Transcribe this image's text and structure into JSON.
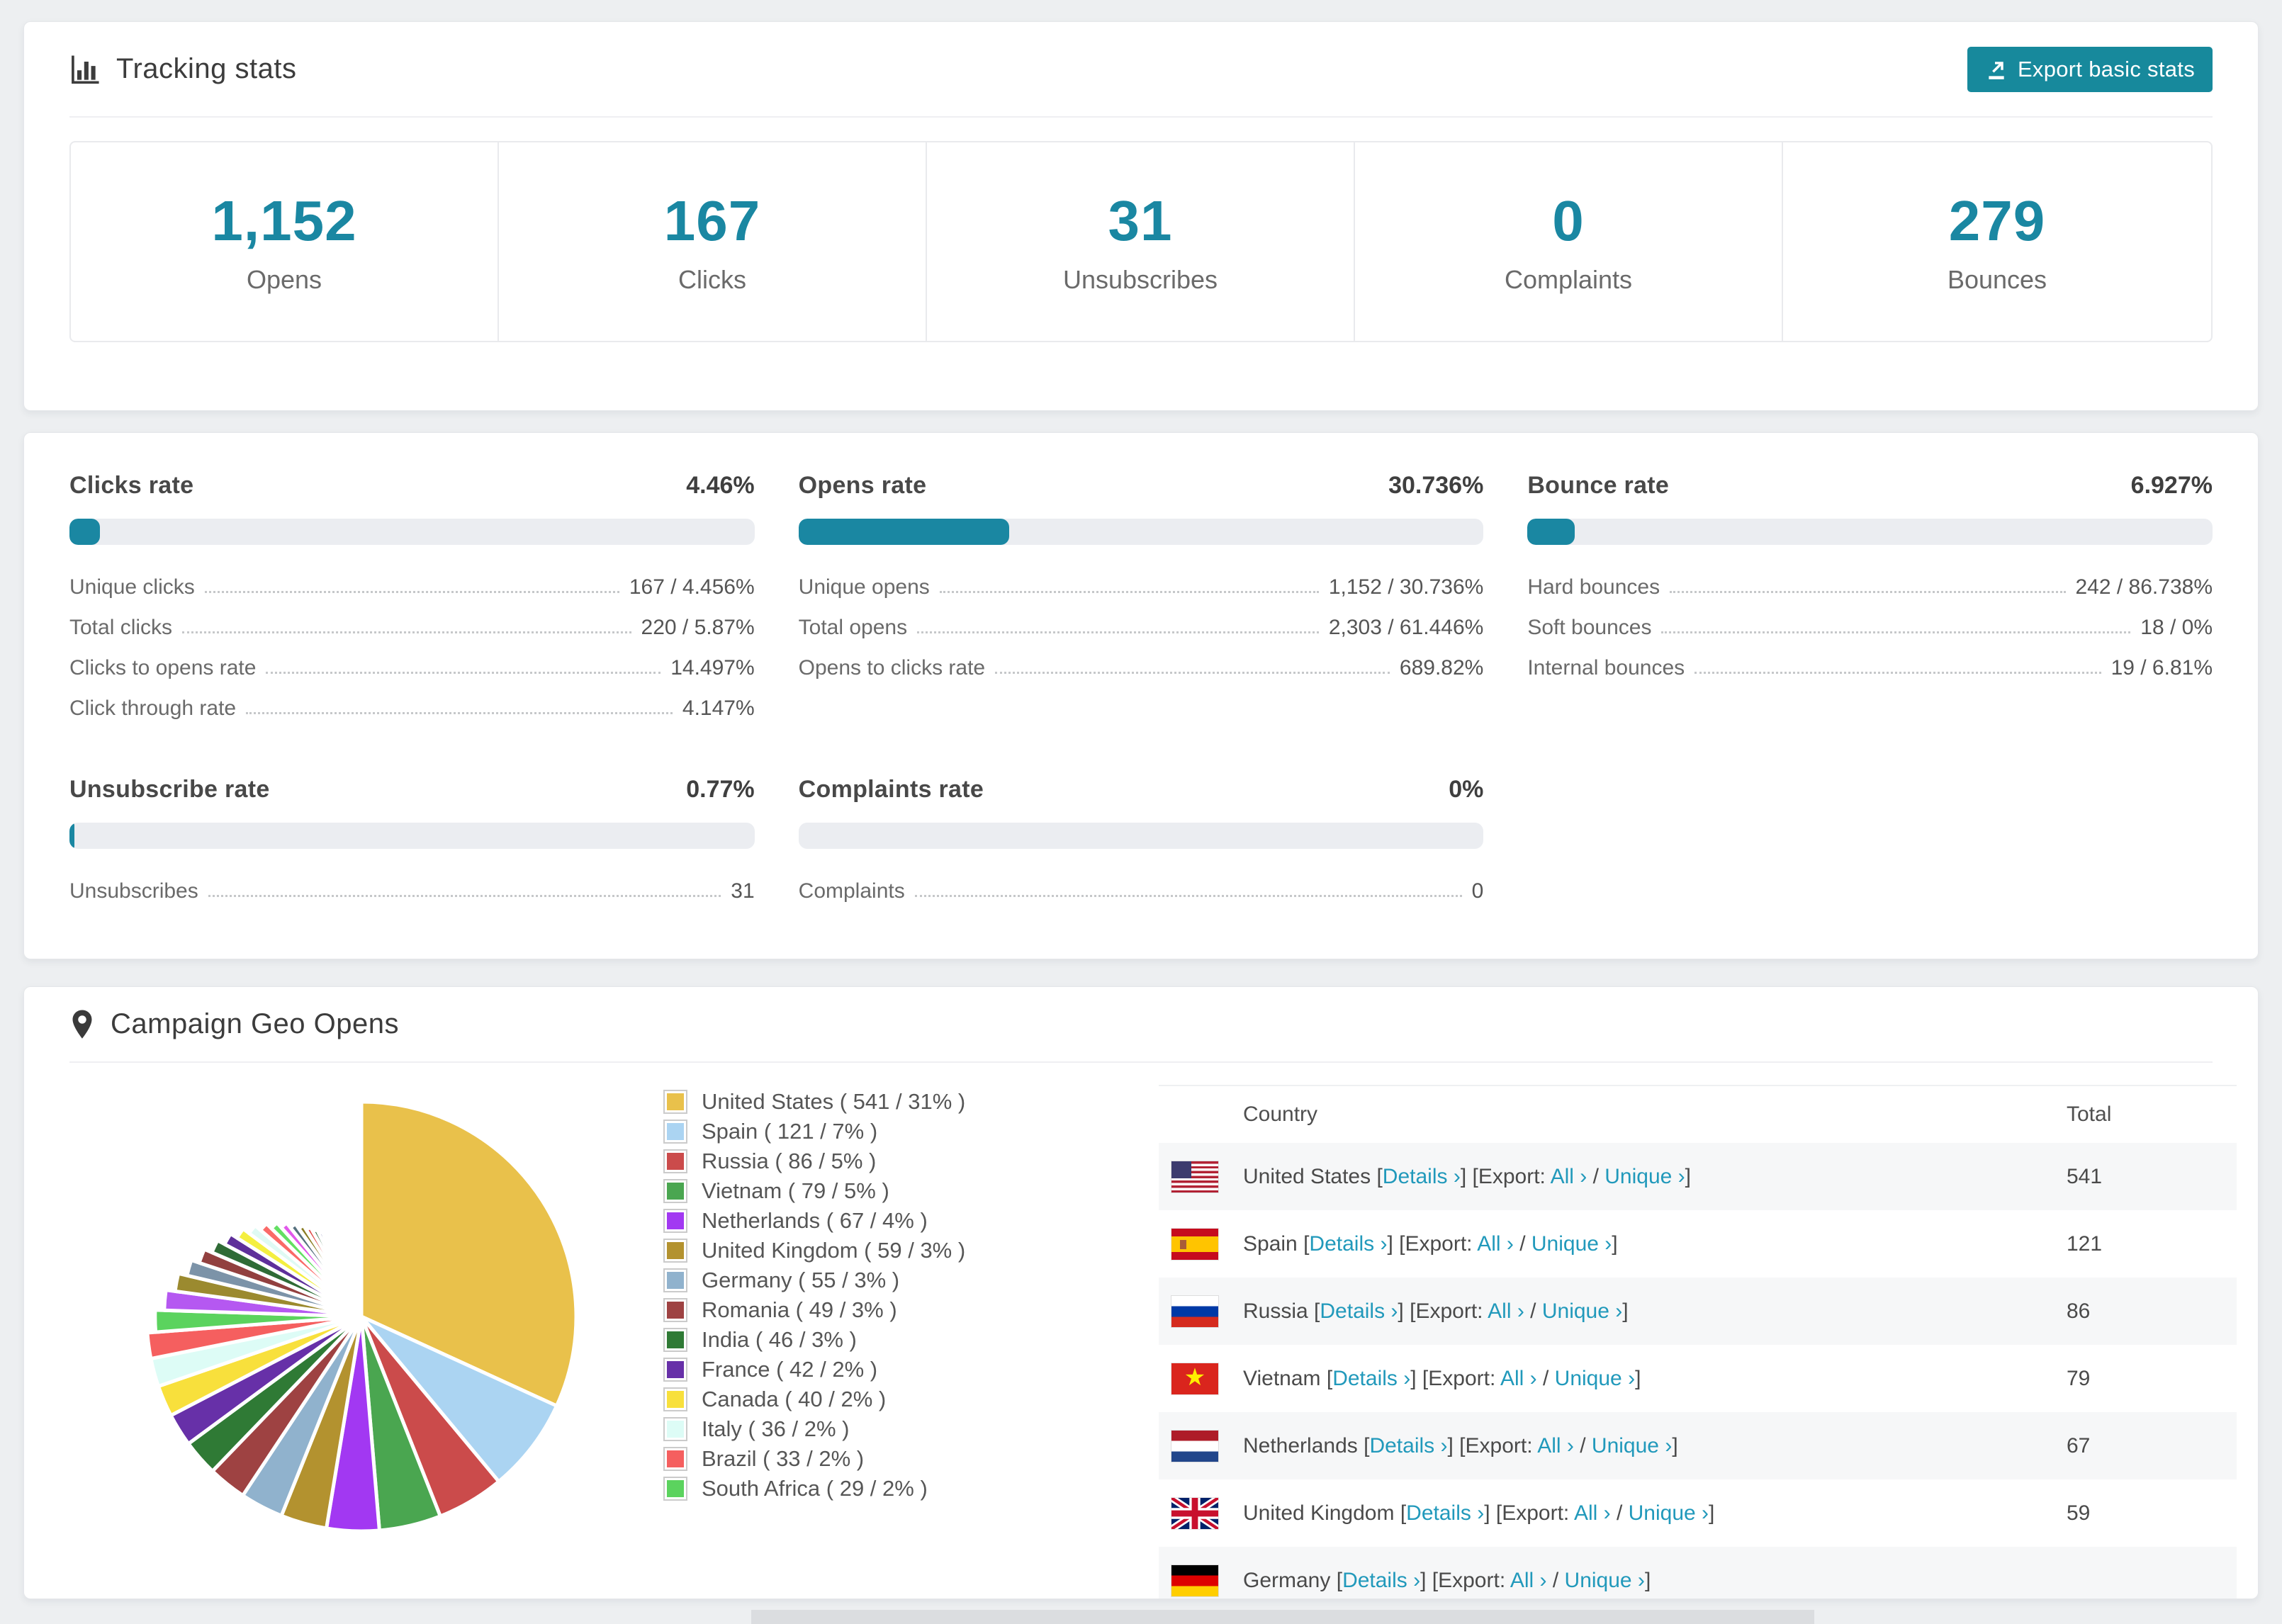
{
  "page": {
    "background": "#edeff1",
    "accent_color": "#1a87a2"
  },
  "tracking_card": {
    "title": "Tracking stats",
    "icon": "bar-chart-icon",
    "export_button": {
      "label": "Export basic stats",
      "icon": "export-icon",
      "color": "#17899c"
    },
    "stats": [
      {
        "value": "1,152",
        "label": "Opens"
      },
      {
        "value": "167",
        "label": "Clicks"
      },
      {
        "value": "31",
        "label": "Unsubscribes"
      },
      {
        "value": "0",
        "label": "Complaints"
      },
      {
        "value": "279",
        "label": "Bounces"
      }
    ]
  },
  "rates_card": {
    "blocks": [
      {
        "title": "Clicks rate",
        "value": "4.46%",
        "percent": 4.46,
        "rows": [
          {
            "label": "Unique clicks",
            "value": "167 / 4.456%"
          },
          {
            "label": "Total clicks",
            "value": "220 / 5.87%"
          },
          {
            "label": "Clicks to opens rate",
            "value": "14.497%"
          },
          {
            "label": "Click through rate",
            "value": "4.147%"
          }
        ]
      },
      {
        "title": "Opens rate",
        "value": "30.736%",
        "percent": 30.736,
        "rows": [
          {
            "label": "Unique opens",
            "value": "1,152 / 30.736%"
          },
          {
            "label": "Total opens",
            "value": "2,303 / 61.446%"
          },
          {
            "label": "Opens to clicks rate",
            "value": "689.82%"
          }
        ]
      },
      {
        "title": "Bounce rate",
        "value": "6.927%",
        "percent": 6.927,
        "rows": [
          {
            "label": "Hard bounces",
            "value": "242 / 86.738%"
          },
          {
            "label": "Soft bounces",
            "value": "18 / 0%"
          },
          {
            "label": "Internal bounces",
            "value": "19 / 6.81%"
          }
        ]
      },
      {
        "title": "Unsubscribe rate",
        "value": "0.77%",
        "percent": 0.77,
        "rows": [
          {
            "label": "Unsubscribes",
            "value": "31"
          }
        ]
      },
      {
        "title": "Complaints rate",
        "value": "0%",
        "percent": 0,
        "rows": [
          {
            "label": "Complaints",
            "value": "0"
          }
        ]
      }
    ]
  },
  "geo_card": {
    "title": "Campaign Geo Opens",
    "icon": "map-pin-icon",
    "chart_data": {
      "type": "pie",
      "title": "Campaign Geo Opens",
      "legend_position": "right",
      "start_angle_deg": 0,
      "direction": "clockwise",
      "slices": [
        {
          "name": "United States",
          "value": 541,
          "legend": "United States ( 541 / 31% )",
          "color": "#e9c14b"
        },
        {
          "name": "Spain",
          "value": 121,
          "legend": "Spain ( 121 / 7% )",
          "color": "#abd4f2"
        },
        {
          "name": "Russia",
          "value": 86,
          "legend": "Russia ( 86 / 5% )",
          "color": "#cb4b4b"
        },
        {
          "name": "Vietnam",
          "value": 79,
          "legend": "Vietnam ( 79 / 5% )",
          "color": "#4aa650"
        },
        {
          "name": "Netherlands",
          "value": 67,
          "legend": "Netherlands ( 67 / 4% )",
          "color": "#a238f2"
        },
        {
          "name": "United Kingdom",
          "value": 59,
          "legend": "United Kingdom ( 59 / 3% )",
          "color": "#b3922f"
        },
        {
          "name": "Germany",
          "value": 55,
          "legend": "Germany ( 55 / 3% )",
          "color": "#90b2cd"
        },
        {
          "name": "Romania",
          "value": 49,
          "legend": "Romania ( 49 / 3% )",
          "color": "#9e4242"
        },
        {
          "name": "India",
          "value": 46,
          "legend": "India ( 46 / 3% )",
          "color": "#2f7a35"
        },
        {
          "name": "France",
          "value": 42,
          "legend": "France ( 42 / 2% )",
          "color": "#6730a8"
        },
        {
          "name": "Canada",
          "value": 40,
          "legend": "Canada ( 40 / 2% )",
          "color": "#f8e03c"
        },
        {
          "name": "Italy",
          "value": 36,
          "legend": "Italy ( 36 / 2% )",
          "color": "#ddfcf6"
        },
        {
          "name": "Brazil",
          "value": 33,
          "legend": "Brazil ( 33 / 2% )",
          "color": "#f55f5f"
        },
        {
          "name": "South Africa",
          "value": 29,
          "legend": "South Africa ( 29 / 2% )",
          "color": "#5bd35e"
        }
      ],
      "tail_slices": {
        "comment_values_are_estimates_of_unlabeled_small_slices": true,
        "values": [
          28,
          26,
          24,
          23,
          22,
          21,
          20,
          19,
          18,
          17,
          16,
          15,
          14,
          13,
          12,
          11,
          10,
          9.5,
          9,
          8.5,
          8,
          7.5,
          7,
          6.5,
          6,
          5.5,
          5,
          4.5,
          4,
          3.5,
          3,
          2.8,
          2.6,
          2.4,
          2.2,
          2,
          1.8,
          1.6,
          1.4,
          1.2,
          1,
          0.9
        ],
        "palette": [
          "#b558f1",
          "#9b8a2f",
          "#7c93a8",
          "#92403f",
          "#2f6b36",
          "#5e2f9a",
          "#f4ef40",
          "#dffaf4",
          "#fa6a68",
          "#63df63",
          "#e158ea",
          "#56707e",
          "#8a7c22",
          "#df4a47",
          "#205c31",
          "#302e84",
          "#f2ee48",
          "#7c2121",
          "#65788c",
          "#8a8a26"
        ]
      }
    },
    "table": {
      "columns": [
        "Country",
        "Total"
      ],
      "labels": {
        "bracket_open": "[",
        "bracket_close": "]",
        "details": "Details ›",
        "export_prefix": "[Export: ",
        "all": "All ›",
        "separator": " / ",
        "unique": "Unique ›",
        "space": " "
      },
      "rows": [
        {
          "flag": "us",
          "country": "United States",
          "total": "541"
        },
        {
          "flag": "es",
          "country": "Spain",
          "total": "121"
        },
        {
          "flag": "ru",
          "country": "Russia",
          "total": "86"
        },
        {
          "flag": "vn",
          "country": "Vietnam",
          "total": "79"
        },
        {
          "flag": "nl",
          "country": "Netherlands",
          "total": "67"
        },
        {
          "flag": "gb",
          "country": "United Kingdom",
          "total": "59"
        },
        {
          "flag": "de",
          "country": "Germany",
          "total": ""
        }
      ]
    }
  }
}
